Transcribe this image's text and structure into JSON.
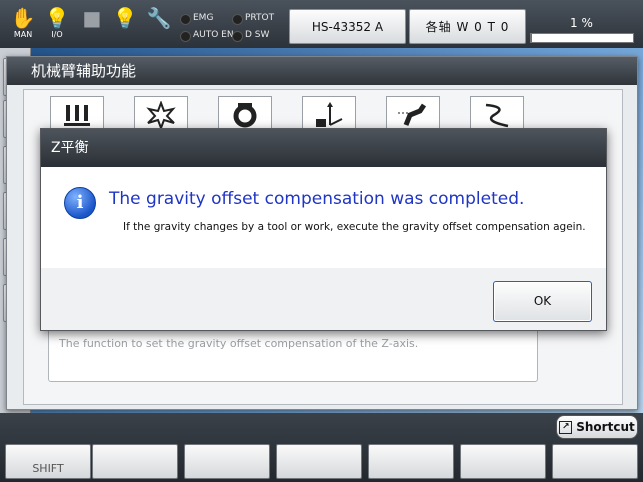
{
  "topbar": {
    "man_label": "MAN",
    "io_label": "I/O",
    "status": {
      "emg": "EMG",
      "prtot": "PRTOT",
      "auto_en": "AUTO EN",
      "dsw": "D SW"
    },
    "job_button": "HS-43352 A",
    "axis_button": "各轴  W 0 T 0",
    "percent": "1 %",
    "percent_value": 1
  },
  "assist_window": {
    "title": "机械臂辅助功能",
    "functions": [
      {
        "icon": "tool-axes-icon"
      },
      {
        "icon": "collision-icon"
      },
      {
        "icon": "gear-tool-icon"
      },
      {
        "icon": "coordinate-axes-icon"
      },
      {
        "icon": "robot-arm-icon"
      },
      {
        "icon": "path-icon"
      }
    ],
    "description": "The function to set the gravity offset compensation of the Z-axis."
  },
  "dialog": {
    "title": "Z平衡",
    "icon": "info-icon",
    "message": "The gravity offset compensation was completed.",
    "detail": "If the gravity changes by a tool or work, execute the gravity offset compensation agein.",
    "ok_label": "OK"
  },
  "bottombar": {
    "shortcut_label": "Shortcut",
    "fkeys": [
      "SHIFT",
      "",
      "",
      "",
      "",
      "",
      ""
    ]
  },
  "colors": {
    "dialog_message": "#1f35c4",
    "title_bar": "#2f343a",
    "accent": "#2d5fb3"
  }
}
